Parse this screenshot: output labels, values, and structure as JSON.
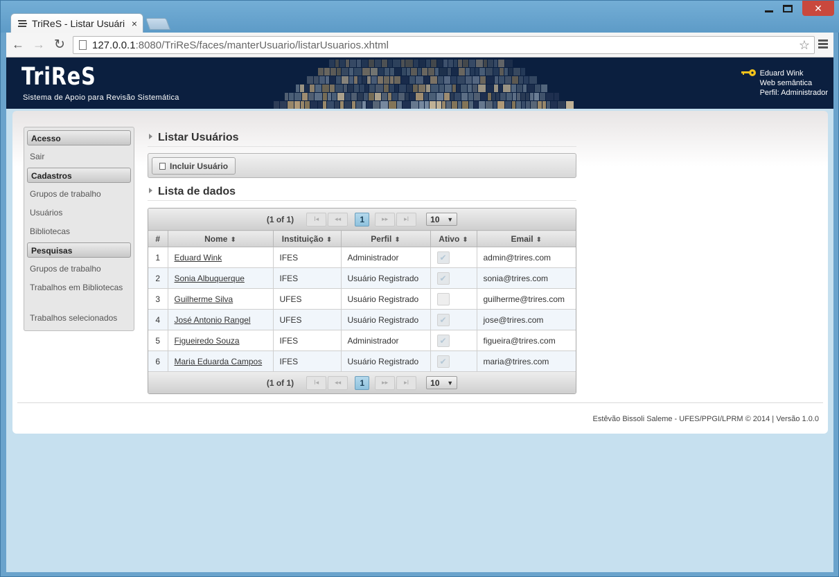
{
  "browser": {
    "tab_title": "TriReS - Listar Usuári",
    "tab_close": "×",
    "url_host": "127.0.0.1",
    "url_rest": ":8080/TriReS/faces/manterUsuario/listarUsuarios.xhtml"
  },
  "banner": {
    "logo": "TriReS",
    "subtitle": "Sistema de Apoio para Revisão Sistemática",
    "user_name": "Eduard Wink",
    "user_group": "Web semântica",
    "user_profile": "Perfil: Administrador"
  },
  "sidebar": {
    "sections": [
      {
        "title": "Acesso",
        "items": [
          "Sair"
        ]
      },
      {
        "title": "Cadastros",
        "items": [
          "Grupos de trabalho",
          "Usuários",
          "Bibliotecas"
        ]
      },
      {
        "title": "Pesquisas",
        "items": [
          "Grupos de trabalho",
          "Trabalhos em Bibliotecas",
          "Trabalhos selecionados"
        ]
      }
    ]
  },
  "main": {
    "title": "Listar Usuários",
    "add_button": "Incluir Usuário",
    "list_title": "Lista de dados"
  },
  "table": {
    "pager_text": "(1 of 1)",
    "pager_first": "I◂",
    "pager_prev": "◂◂",
    "pager_page": "1",
    "pager_next": "▸▸",
    "pager_last": "▸I",
    "rows_per_page": "10",
    "dropdown_arrow": "▼",
    "columns": [
      "#",
      "Nome",
      "Instituição",
      "Perfil",
      "Ativo",
      "Email"
    ],
    "rows": [
      {
        "n": "1",
        "nome": "Eduard Wink",
        "inst": "IFES",
        "perfil": "Administrador",
        "ativo": true,
        "email": "admin@trires.com"
      },
      {
        "n": "2",
        "nome": "Sonia Albuquerque",
        "inst": "IFES",
        "perfil": "Usuário Registrado",
        "ativo": true,
        "email": "sonia@trires.com"
      },
      {
        "n": "3",
        "nome": "Guilherme Silva",
        "inst": "UFES",
        "perfil": "Usuário Registrado",
        "ativo": false,
        "email": "guilherme@trires.com"
      },
      {
        "n": "4",
        "nome": "José Antonio Rangel",
        "inst": "UFES",
        "perfil": "Usuário Registrado",
        "ativo": true,
        "email": "jose@trires.com"
      },
      {
        "n": "5",
        "nome": "Figueiredo Souza",
        "inst": "IFES",
        "perfil": "Administrador",
        "ativo": true,
        "email": "figueira@trires.com"
      },
      {
        "n": "6",
        "nome": "Maria Eduarda Campos",
        "inst": "IFES",
        "perfil": "Usuário Registrado",
        "ativo": true,
        "email": "maria@trires.com"
      }
    ]
  },
  "footer": {
    "text": "Estêvão Bissoli Saleme - UFES/PPGI/LPRM © 2014 | Versão 1.0.0"
  }
}
